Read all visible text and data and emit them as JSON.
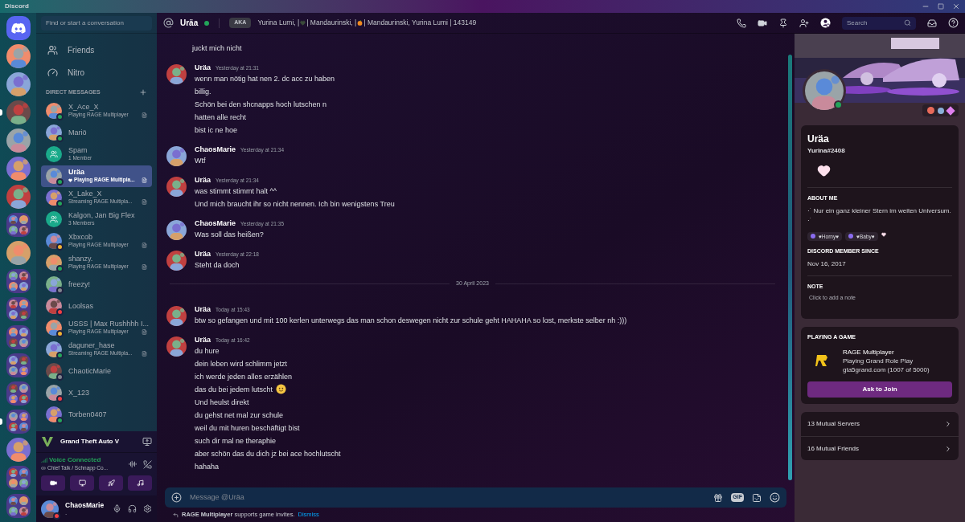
{
  "window": {
    "title": "Discord"
  },
  "servers": [
    {
      "kind": "home",
      "unread": false
    },
    {
      "kind": "server",
      "unread": false
    },
    {
      "kind": "server",
      "unread": false
    },
    {
      "kind": "server",
      "unread": true
    },
    {
      "kind": "server",
      "unread": false
    },
    {
      "kind": "server",
      "unread": false
    },
    {
      "kind": "server",
      "unread": false
    },
    {
      "kind": "folder",
      "unread": false
    },
    {
      "kind": "server",
      "unread": false
    },
    {
      "kind": "folder",
      "unread": false
    },
    {
      "kind": "folder",
      "unread": false
    },
    {
      "kind": "folder",
      "unread": false
    },
    {
      "kind": "folder",
      "unread": false
    },
    {
      "kind": "folder",
      "unread": false
    },
    {
      "kind": "folder",
      "unread": true
    },
    {
      "kind": "server",
      "unread": false
    },
    {
      "kind": "folder",
      "unread": false
    },
    {
      "kind": "folder",
      "unread": false
    }
  ],
  "sidebar": {
    "search": {
      "placeholder": "Find or start a conversation"
    },
    "nav": [
      {
        "kind": "friends",
        "label": "Friends"
      },
      {
        "kind": "nitro",
        "label": "Nitro"
      }
    ],
    "section": "DIRECT MESSAGES",
    "dms": [
      {
        "kind": "user",
        "name": "X_Ace_X",
        "activity": "Playing RAGE Multiplayer",
        "color": "#23a55a",
        "selected": false
      },
      {
        "kind": "user",
        "name": "Mariö",
        "color": "#23a55a",
        "selected": false
      },
      {
        "kind": "group",
        "name": "Spam",
        "activity": "1 Member",
        "selected": false
      },
      {
        "kind": "user",
        "name": "Uräa",
        "activity": "Playing RAGE Multipla...",
        "color": "#23a55a",
        "selected": true,
        "heart": true
      },
      {
        "kind": "user",
        "name": "X_Lake_X",
        "activity": "Streaming RAGE Multipla...",
        "color": "#23a55a",
        "selected": false
      },
      {
        "kind": "group",
        "name": "Kalgon, Jan Big Flex",
        "activity": "3 Members",
        "selected": false
      },
      {
        "kind": "user",
        "name": "Xbxcob",
        "activity": "Playing RAGE Multiplayer",
        "color": "#f0b232",
        "selected": false
      },
      {
        "kind": "user",
        "name": "shanzy.",
        "activity": "Playing RAGE Multiplayer",
        "color": "#23a55a",
        "selected": false
      },
      {
        "kind": "user",
        "name": "freezy!",
        "color": "#80848e",
        "selected": false
      },
      {
        "kind": "user",
        "name": "Loolsas",
        "color": "#f23f43",
        "selected": false
      },
      {
        "kind": "user",
        "name": "USSS | Max Rushhhh I...",
        "activity": "Playing RAGE Multiplayer",
        "color": "#f0b232",
        "selected": false
      },
      {
        "kind": "user",
        "name": "daguner_hase",
        "activity": "Streaming RAGE Multipla...",
        "color": "#23a55a",
        "selected": false
      },
      {
        "kind": "user",
        "name": "ChaoticMarie",
        "color": "#80848e",
        "selected": false
      },
      {
        "kind": "user",
        "name": "X_123",
        "color": "#f23f43",
        "selected": false
      },
      {
        "kind": "user",
        "name": "Torben0407",
        "color": "#23a55a",
        "selected": false
      }
    ],
    "game": {
      "title": "Grand Theft Auto V"
    },
    "voice": {
      "status": "Voice Connected",
      "channel": "Chief Talk / Schnapp Co..."
    },
    "user": {
      "name": "ChaosMarie",
      "custom_status": ".",
      "color": "#f23f43"
    }
  },
  "header": {
    "name": "Uräa",
    "color": "#23a55a",
    "aka_label": "AKA",
    "aka_parts": [
      "Yurina Lumi, |",
      "| Mandaurinski, |",
      "| Mandaurinski, Yurina Lumi | 143149"
    ],
    "search_placeholder": "Search"
  },
  "messages": [
    {
      "kind": "continuation",
      "lines": [
        {
          "text": "juckt mich nicht"
        }
      ]
    },
    {
      "kind": "group",
      "author": "Uräa",
      "time": "Yesterday at 21:31",
      "lines": [
        {
          "text": "wenn man nötig hat nen 2. dc acc zu haben"
        },
        {
          "text": "billig."
        },
        {
          "text": "Schön bei den shcnapps hoch lutschen n"
        },
        {
          "text": "hatten alle recht"
        },
        {
          "text": "bist ic ne hoe"
        }
      ]
    },
    {
      "kind": "group",
      "author": "ChaosMarie",
      "time": "Yesterday at 21:34",
      "lines": [
        {
          "text": "Wtf"
        }
      ]
    },
    {
      "kind": "group",
      "author": "Uräa",
      "time": "Yesterday at 21:34",
      "lines": [
        {
          "text": "was stimmt stimmt halt ^^"
        },
        {
          "text": "Und mich braucht ihr so nicht nennen. Ich bin wenigstens Treu"
        }
      ]
    },
    {
      "kind": "group",
      "author": "ChaosMarie",
      "time": "Yesterday at 21:35",
      "lines": [
        {
          "text": "Was soll das heißen?"
        }
      ]
    },
    {
      "kind": "group",
      "author": "Uräa",
      "time": "Yesterday at 22:18",
      "lines": [
        {
          "text": "Steht da doch"
        }
      ]
    },
    {
      "kind": "divider",
      "label": "30 April 2023"
    },
    {
      "kind": "group",
      "author": "Uräa",
      "time": "Today at 15:43",
      "lines": [
        {
          "text": "btw so gefangen und mit 100 kerlen unterwegs das man schon deswegen nicht zur schule geht HAHAHA so lost, merkste selber nh :)))"
        }
      ]
    },
    {
      "kind": "group",
      "author": "Uräa",
      "time": "Today at 16:42",
      "lines": [
        {
          "text": "du hure"
        },
        {
          "text": "dein leben wird schlimm jetzt"
        },
        {
          "text": "ich werde jeden alles erzählen"
        },
        {
          "text": "das du bei jedem lutscht",
          "emoji": true
        },
        {
          "text": "Und heulst direkt"
        },
        {
          "text": "du gehst net mal zur schule"
        },
        {
          "text": "weil du mit huren beschäftigt bist"
        },
        {
          "text": "such dir mal ne theraphie"
        },
        {
          "text": "aber schön das du dich jz bei ace hochlutscht"
        },
        {
          "text": "hahaha"
        }
      ]
    }
  ],
  "composer": {
    "placeholder": "Message @Uräa",
    "gif": "GIF"
  },
  "invite_notice": {
    "text": "**RAGE Multiplayer** supports game invites.",
    "link": "Dismiss"
  },
  "profile": {
    "name": "Uräa",
    "tag": "Yurina#2408",
    "about_heading": "ABOUT ME",
    "about": "·˙ Nur ein ganz kleiner Stern im weiten Universum. ·˙",
    "roles": [
      {
        "name": "♥Horny♥",
        "color": "#8b6cf0"
      },
      {
        "name": "♥Baby♥",
        "color": "#8b6cf0"
      }
    ],
    "member_heading": "DISCORD MEMBER SINCE",
    "member_since": "Nov 16, 2017",
    "note_heading": "NOTE",
    "note_placeholder": "Click to add a note",
    "game": {
      "heading": "PLAYING A GAME",
      "name": "RAGE Multiplayer",
      "details": "Playing Grand Role Play",
      "state": "gta5grand.com (1007 of 5000)",
      "button": "Ask to Join"
    },
    "mutual": [
      {
        "label": "13 Mutual Servers"
      },
      {
        "label": "16 Mutual Friends"
      }
    ]
  }
}
